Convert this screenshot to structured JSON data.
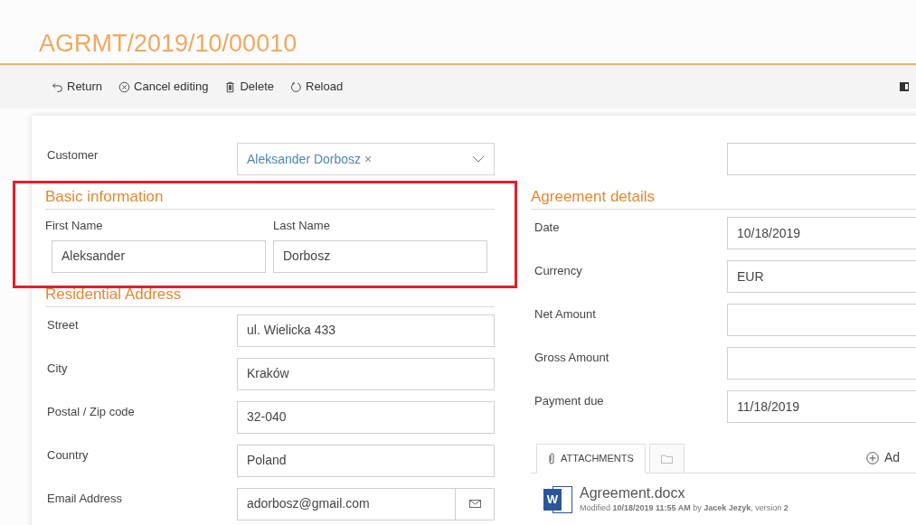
{
  "title": "AGRMT/2019/10/00010",
  "toolbar": [
    {
      "kind": "return",
      "label": "Return"
    },
    {
      "kind": "cancel",
      "label": "Cancel editing"
    },
    {
      "kind": "delete",
      "label": "Delete"
    },
    {
      "kind": "reload",
      "label": "Reload"
    }
  ],
  "customer": {
    "label": "Customer",
    "value": "Aleksander Dorbosz",
    "remove": "×"
  },
  "basic_information": {
    "heading": "Basic information",
    "fields": [
      {
        "label": "First Name",
        "value": "Aleksander"
      },
      {
        "label": "Last Name",
        "value": "Dorbosz"
      }
    ]
  },
  "residential_address": {
    "heading": "Residential Address",
    "fields": [
      {
        "kind": "text",
        "label": "Street",
        "value": "ul. Wielicka 433"
      },
      {
        "kind": "text",
        "label": "City",
        "value": "Kraków"
      },
      {
        "kind": "text",
        "label": "Postal / Zip code",
        "value": "32-040"
      },
      {
        "kind": "text",
        "label": "Country",
        "value": "Poland"
      },
      {
        "kind": "email",
        "label": "Email Address",
        "value": "adorbosz@gmail.com"
      }
    ]
  },
  "agreement_details": {
    "heading": "Agreement details",
    "fields": [
      {
        "label": "Date",
        "value": "10/18/2019"
      },
      {
        "label": "Currency",
        "value": "EUR"
      },
      {
        "label": "Net Amount"
      },
      {
        "label": "Gross Amount"
      },
      {
        "label": "Payment due",
        "value": "11/18/2019"
      }
    ]
  },
  "attachment_tabs": [
    {
      "kind": "attachments",
      "label": "ATTACHMENTS",
      "selected": true
    },
    {
      "kind": "folder",
      "selected": false
    }
  ],
  "add_button": "Ad",
  "attachments": [
    {
      "icon_letter": "W",
      "name": "Agreement.docx",
      "info": "Modified **10/18/2019 11:55 AM** by **Jacek Jezyk**, version **2**"
    }
  ]
}
